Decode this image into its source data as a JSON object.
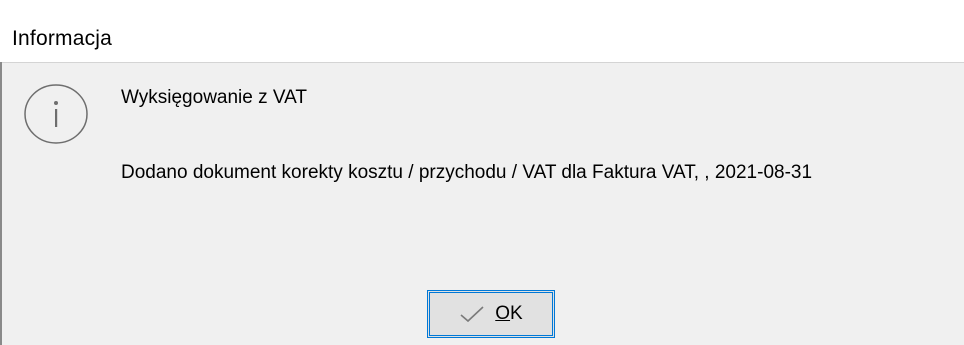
{
  "window": {
    "title": "Informacja"
  },
  "message": {
    "icon": "info-icon",
    "heading": "Wyksięgowanie z VAT",
    "body": "Dodano dokument korekty kosztu / przychodu / VAT dla Faktura VAT, , 2021-08-31"
  },
  "buttons": {
    "ok": {
      "icon": "check-icon",
      "mnemonic": "O",
      "rest": "K"
    }
  },
  "colors": {
    "accent": "#0078d7",
    "button_bg": "#e1e1e1",
    "dialog_bg": "#f0f0f0",
    "titlebar_bg": "#ffffff",
    "icon_stroke": "#6e6e6e"
  }
}
